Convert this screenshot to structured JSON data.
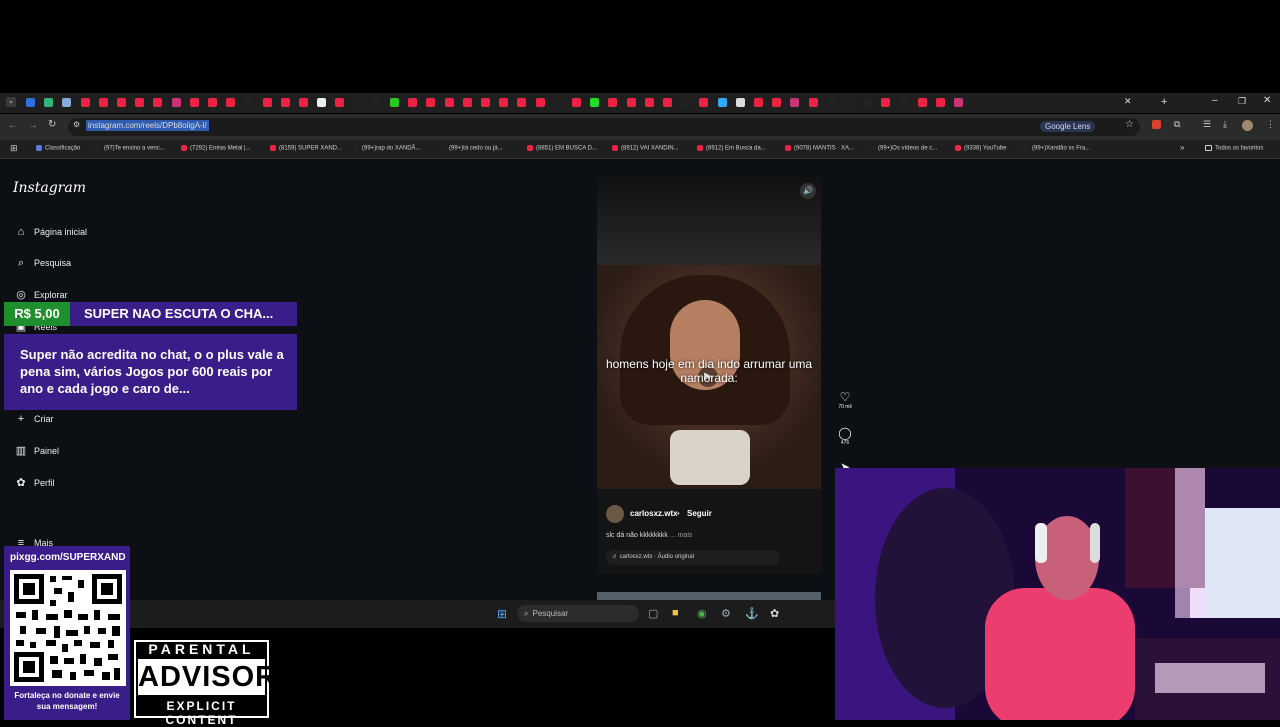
{
  "browser": {
    "url": "instagram.com/reels/DPb8oiigA-l/",
    "lens_label": "Google Lens",
    "bookmarks": [
      "Classificação",
      "(97)Te ensino a venc...",
      "(7292) Enéas Metal |...",
      "(8159) SUPER XAND...",
      "(99+)rap do XANDÃ...",
      "(99+)tá cedo ou já...",
      "(8851) EM BUSCA D...",
      "(8912) VAI XANDIN...",
      "(8912) Em Busca da...",
      "(9078) MANTIS · XA...",
      "(99+)Os vídeos de c...",
      "(9338) YouTube",
      "(99+)Xandão vs Fra..."
    ],
    "all_favorites": "Todos os favoritos"
  },
  "instagram": {
    "logo": "Instagram",
    "nav": [
      {
        "label": "Página inicial",
        "icon": "home-icon"
      },
      {
        "label": "Pesquisa",
        "icon": "search-icon"
      },
      {
        "label": "Explorar",
        "icon": "compass-icon"
      },
      {
        "label": "Reels",
        "icon": "reels-icon"
      },
      {
        "label": "Criar",
        "icon": "plus-icon"
      },
      {
        "label": "Painel",
        "icon": "dashboard-icon"
      },
      {
        "label": "Perfil",
        "icon": "profile-icon"
      },
      {
        "label": "Mais",
        "icon": "menu-icon"
      }
    ],
    "reel": {
      "caption": "homens hoje em dia indo arrumar uma namorada:",
      "username": "carlosxz.wtx",
      "separator": "•",
      "follow": "Seguir",
      "description": "slc dá não kkkkkkkk",
      "more": "... mais",
      "audio": "carlosxz.wtx · Áudio original",
      "likes": "70 mil",
      "comments": "476"
    }
  },
  "taskbar": {
    "search_placeholder": "Pesquisar"
  },
  "donation": {
    "amount": "R$ 5,00",
    "name": "SUPER NAO ESCUTA O CHA...",
    "message": "Super não acredita no chat, o o plus vale a pena sim, vários Jogos por 600 reais por ano e cada jogo e caro de..."
  },
  "qr": {
    "url": "pixgg.com/SUPERXAND",
    "text": "Fortaleça no donate e envie sua mensagem!"
  },
  "parental_advisory": {
    "line1": "PARENTAL",
    "line2": "ADVISORY",
    "line3": "EXPLICIT CONTENT"
  }
}
